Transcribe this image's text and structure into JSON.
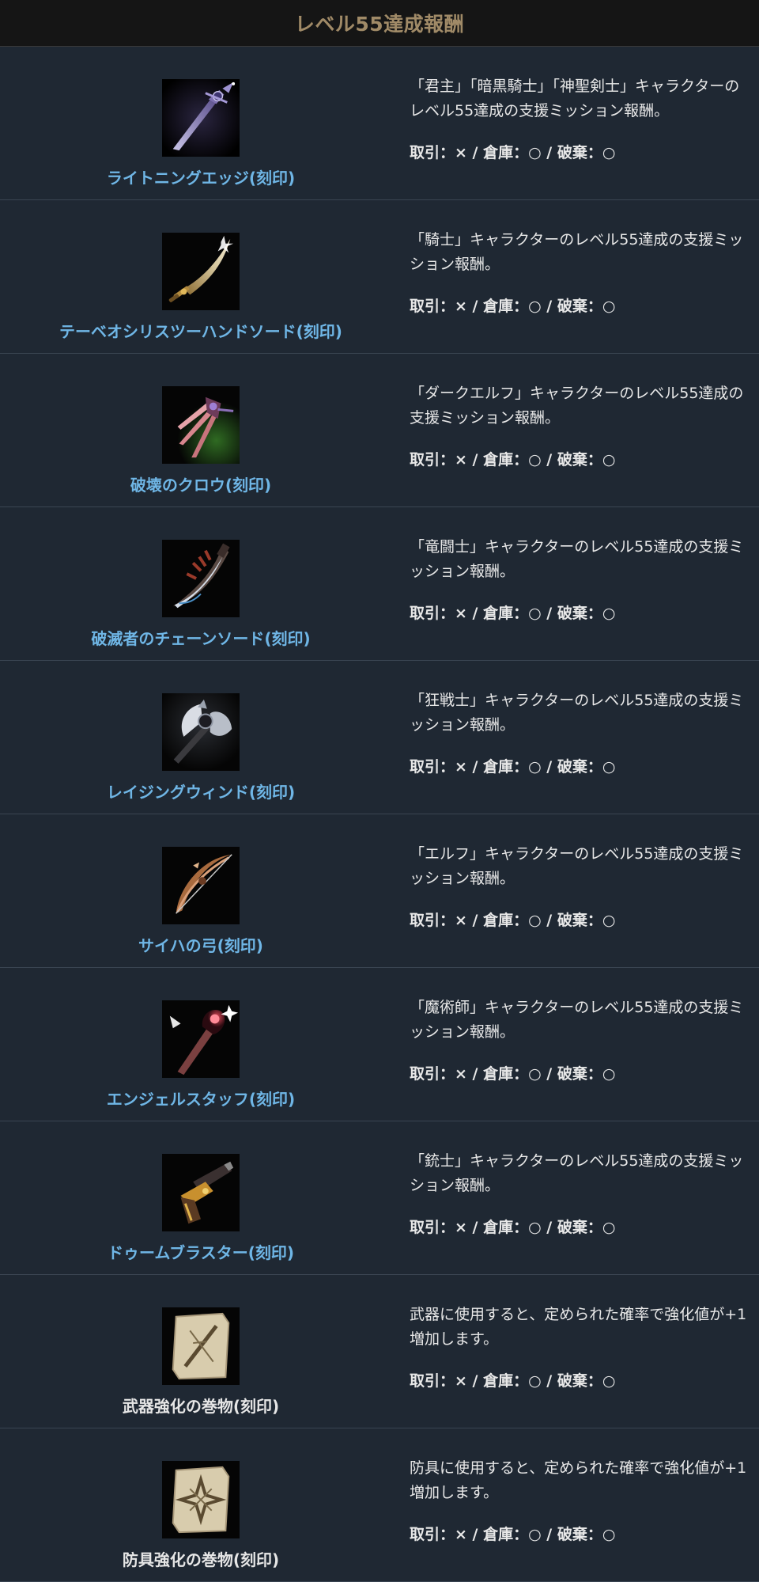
{
  "header": {
    "title": "レベル55達成報酬"
  },
  "items": [
    {
      "name": "ライトニングエッジ(刻印)",
      "icon": "dagger-icon",
      "description": "「君主」「暗黒騎士」「神聖剣士」キャラクターのレベル55達成の支援ミッション報酬。",
      "trade": "取引：× / 倉庫：○ / 破棄：○",
      "name_color": "blue"
    },
    {
      "name": "テーベオシリスツーハンドソード(刻印)",
      "icon": "scimitar-icon",
      "description": "「騎士」キャラクターのレベル55達成の支援ミッション報酬。",
      "trade": "取引：× / 倉庫：○ / 破棄：○",
      "name_color": "blue"
    },
    {
      "name": "破壊のクロウ(刻印)",
      "icon": "claw-icon",
      "description": "「ダークエルフ」キャラクターのレベル55達成の支援ミッション報酬。",
      "trade": "取引：× / 倉庫：○ / 破棄：○",
      "name_color": "blue"
    },
    {
      "name": "破滅者のチェーンソード(刻印)",
      "icon": "chain-sword-icon",
      "description": "「竜闘士」キャラクターのレベル55達成の支援ミッション報酬。",
      "trade": "取引：× / 倉庫：○ / 破棄：○",
      "name_color": "blue"
    },
    {
      "name": "レイジングウィンド(刻印)",
      "icon": "axe-icon",
      "description": "「狂戦士」キャラクターのレベル55達成の支援ミッション報酬。",
      "trade": "取引：× / 倉庫：○ / 破棄：○",
      "name_color": "blue"
    },
    {
      "name": "サイハの弓(刻印)",
      "icon": "bow-icon",
      "description": "「エルフ」キャラクターのレベル55達成の支援ミッション報酬。",
      "trade": "取引：× / 倉庫：○ / 破棄：○",
      "name_color": "blue"
    },
    {
      "name": "エンジェルスタッフ(刻印)",
      "icon": "staff-icon",
      "description": "「魔術師」キャラクターのレベル55達成の支援ミッション報酬。",
      "trade": "取引：× / 倉庫：○ / 破棄：○",
      "name_color": "blue"
    },
    {
      "name": "ドゥームブラスター(刻印)",
      "icon": "pistol-icon",
      "description": "「銃士」キャラクターのレベル55達成の支援ミッション報酬。",
      "trade": "取引：× / 倉庫：○ / 破棄：○",
      "name_color": "blue"
    },
    {
      "name": "武器強化の巻物(刻印)",
      "icon": "weapon-scroll-icon",
      "description": "武器に使用すると、定められた確率で強化値が+1増加します。",
      "trade": "取引：× / 倉庫：○ / 破棄：○",
      "name_color": "white"
    },
    {
      "name": "防具強化の巻物(刻印)",
      "icon": "armor-scroll-icon",
      "description": "防具に使用すると、定められた確率で強化値が+1増加します。",
      "trade": "取引：× / 倉庫：○ / 破棄：○",
      "name_color": "white"
    }
  ]
}
